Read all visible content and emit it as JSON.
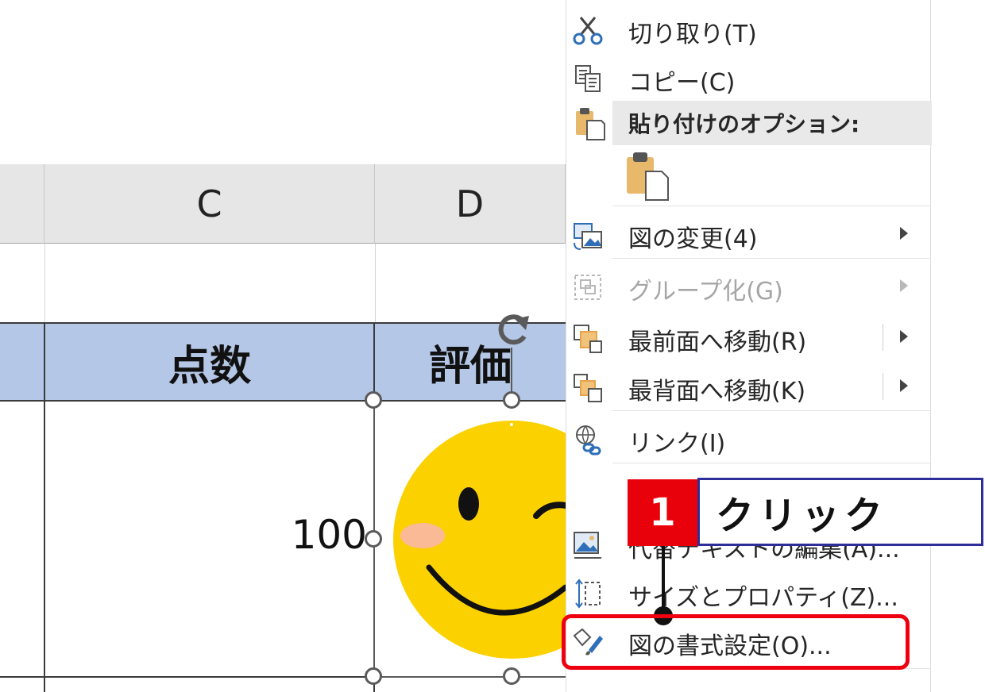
{
  "sheet": {
    "columns": [
      "C",
      "D"
    ],
    "table_headers": [
      "点数",
      "評価"
    ],
    "score_value": "100"
  },
  "context_menu": {
    "items": [
      {
        "label": "切り取り(T)",
        "icon": "scissors-icon",
        "enabled": true
      },
      {
        "label": "コピー(C)",
        "icon": "copy-icon",
        "enabled": true
      },
      {
        "label": "図の変更(4)",
        "icon": "change-picture-icon",
        "enabled": true,
        "submenu": true
      },
      {
        "label": "グループ化(G)",
        "icon": "group-icon",
        "enabled": false,
        "submenu": true
      },
      {
        "label": "最前面へ移動(R)",
        "icon": "bring-to-front-icon",
        "enabled": true,
        "submenu": true
      },
      {
        "label": "最背面へ移動(K)",
        "icon": "send-to-back-icon",
        "enabled": true,
        "submenu": true
      },
      {
        "label": "リンク(I)",
        "icon": "link-icon",
        "enabled": true
      },
      {
        "label": "代替テキストの編集(A)...",
        "icon": "alt-text-icon",
        "enabled": true
      },
      {
        "label": "サイズとプロパティ(Z)...",
        "icon": "size-properties-icon",
        "enabled": true
      },
      {
        "label": "図の書式設定(O)...",
        "icon": "format-picture-icon",
        "enabled": true
      }
    ],
    "paste_options_header": "貼り付けのオプション:"
  },
  "annotation": {
    "step_number": "1",
    "instruction": "クリック",
    "highlight_color": "#ee0010"
  },
  "colors": {
    "header_band": "#b4c7e7",
    "column_header_bg": "#e6e6e6",
    "annotation_red": "#e8000b",
    "annotation_border": "#2e2e9a"
  }
}
